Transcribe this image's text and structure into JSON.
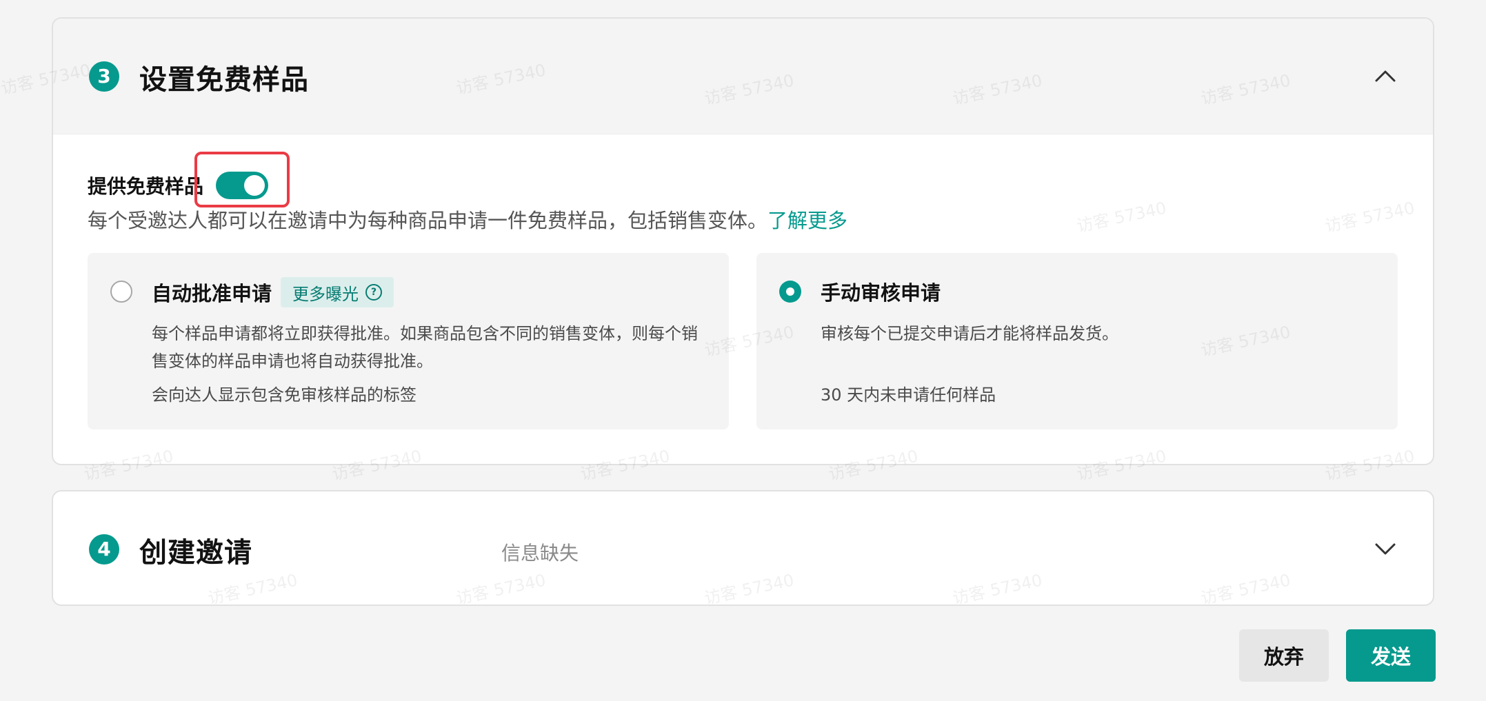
{
  "section3": {
    "step": "3",
    "title": "设置免费样品",
    "toggle_label": "提供免费样品",
    "toggle_on": true,
    "description": "每个受邀达人都可以在邀请中为每种商品申请一件免费样品，包括销售变体。",
    "learn_more": "了解更多",
    "options": {
      "auto": {
        "title": "自动批准申请",
        "tag": "更多曝光",
        "description": "每个样品申请都将立即获得批准。如果商品包含不同的销售变体，则每个销售变体的样品申请也将自动获得批准。",
        "note": "会向达人显示包含免审核样品的标签",
        "selected": false
      },
      "manual": {
        "title": "手动审核申请",
        "description": "审核每个已提交申请后才能将样品发货。",
        "note": "30 天内未申请任何样品",
        "selected": true
      }
    }
  },
  "section4": {
    "step": "4",
    "title": "创建邀请",
    "status": "信息缺失"
  },
  "footer": {
    "discard_label": "放弃",
    "send_label": "发送"
  },
  "watermark_text": "访客 57340",
  "colors": {
    "accent": "#069a8e",
    "highlight": "#ea3b45"
  }
}
